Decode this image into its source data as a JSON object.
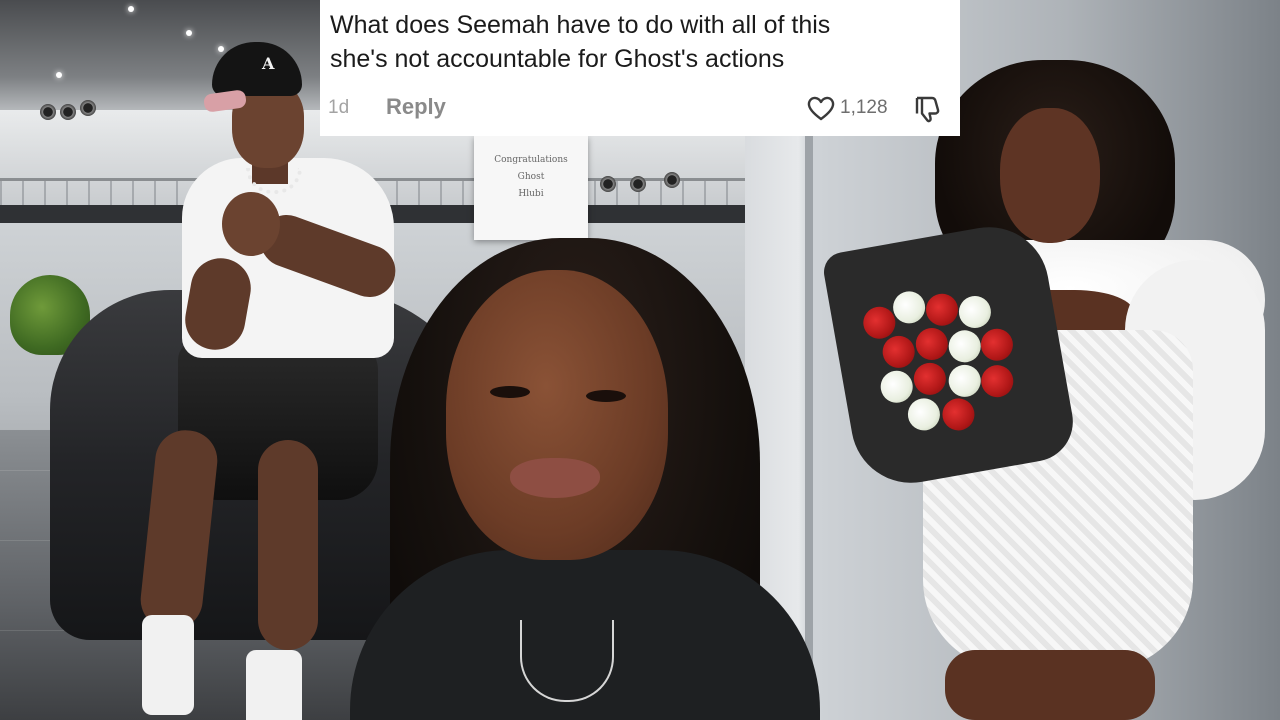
{
  "comment": {
    "lines": [
      "What does Seemah have to do with all of this",
      "she's not accountable for Ghost's actions"
    ],
    "age": "1d",
    "reply_label": "Reply",
    "like_count": "1,128",
    "like_icon": "heart-outline-icon",
    "dislike_icon": "thumbs-down-outline-icon"
  },
  "scene": {
    "sign_lines": [
      "Congratulations",
      "Ghost",
      "Hlubi"
    ],
    "cap_logo": "A"
  },
  "colors": {
    "comment_text": "#1b1b1b",
    "meta_text": "#8a8a8a",
    "card_background": "#ffffff"
  }
}
